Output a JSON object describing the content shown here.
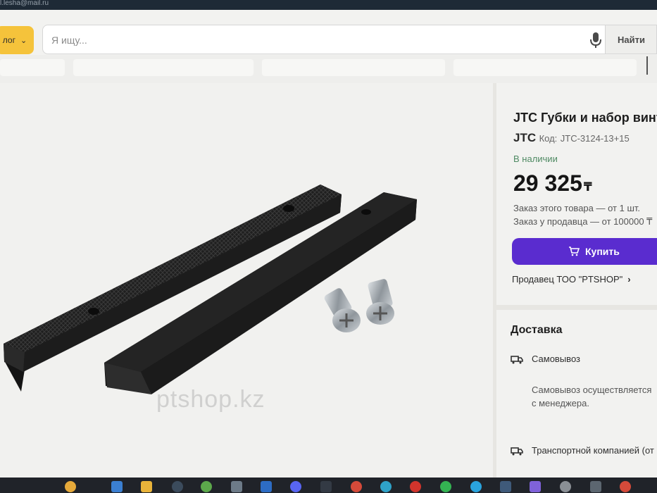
{
  "top_strip": {
    "email_fragment": "l.lesha@mail.ru"
  },
  "header": {
    "catalog_label": "лог",
    "search_placeholder": "Я ищу...",
    "find_label": "Найти"
  },
  "product": {
    "title": "JTC Губки и набор винт",
    "brand": "JTC",
    "code_label": "Код:",
    "code_value": "JTC-3124-13+15",
    "availability": "В наличии",
    "price": "29 325",
    "currency": "₸",
    "order_min": "Заказ этого товара — от 1 шт.",
    "order_seller": "Заказ у продавца — от 100000 ₸",
    "buy_label": "Купить",
    "seller": "Продавец ТОО \"PTSHOP\"",
    "watermark": "ptshop.kz"
  },
  "delivery": {
    "title": "Доставка",
    "pickup_label": "Самовывоз",
    "pickup_desc": "Самовывоз осуществляется с менеджера.",
    "transport_label": "Транспортной компанией (от"
  },
  "colors": {
    "accent": "#5a2ccf",
    "catalog_button": "#f5c33b",
    "in_stock": "#4f8a63"
  }
}
